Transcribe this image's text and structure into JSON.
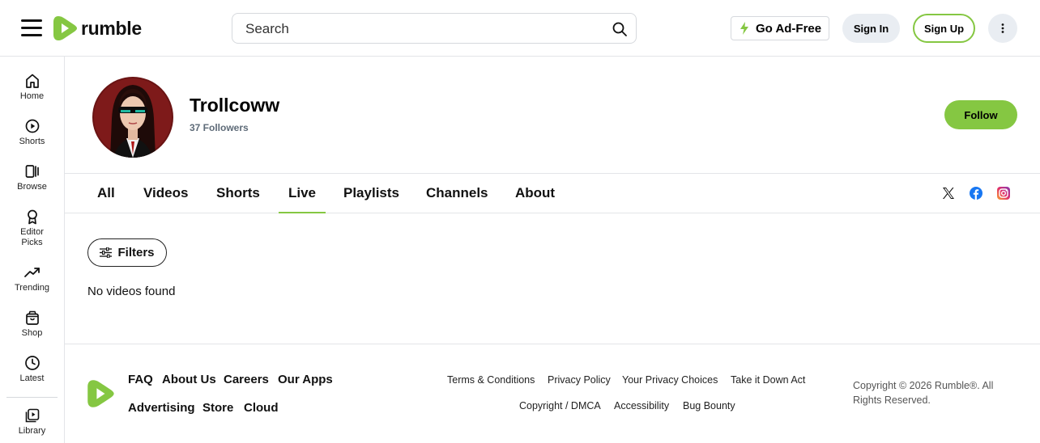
{
  "header": {
    "logo_text": "rumble",
    "search_placeholder": "Search",
    "ad_free_label": "Go Ad-Free",
    "sign_in_label": "Sign In",
    "sign_up_label": "Sign Up"
  },
  "sidebar": {
    "items": [
      {
        "label": "Home",
        "icon": "home-icon"
      },
      {
        "label": "Shorts",
        "icon": "shorts-icon"
      },
      {
        "label": "Browse",
        "icon": "browse-icon"
      },
      {
        "label": "Editor Picks",
        "icon": "ribbon-icon"
      },
      {
        "label": "Trending",
        "icon": "trending-icon"
      },
      {
        "label": "Shop",
        "icon": "shopping-bag-icon"
      },
      {
        "label": "Latest",
        "icon": "clock-icon"
      },
      {
        "label": "Library",
        "icon": "library-icon"
      }
    ]
  },
  "channel": {
    "name": "Trollcoww",
    "followers": "37 Followers",
    "follow_label": "Follow"
  },
  "tabs": [
    {
      "label": "All",
      "active": false
    },
    {
      "label": "Videos",
      "active": false
    },
    {
      "label": "Shorts",
      "active": false
    },
    {
      "label": "Live",
      "active": true
    },
    {
      "label": "Playlists",
      "active": false
    },
    {
      "label": "Channels",
      "active": false
    },
    {
      "label": "About",
      "active": false
    }
  ],
  "social": [
    "x-icon",
    "facebook-icon",
    "instagram-icon"
  ],
  "content": {
    "filters_label": "Filters",
    "empty_message": "No videos found"
  },
  "footer": {
    "primary_links": [
      "FAQ",
      "About Us",
      "Careers",
      "Our Apps",
      "Advertising",
      "Store",
      "Cloud"
    ],
    "secondary_links": [
      "Terms & Conditions",
      "Privacy Policy",
      "Your Privacy Choices",
      "Take it Down Act",
      "Copyright / DMCA",
      "Accessibility",
      "Bug Bounty"
    ],
    "copyright": "Copyright © 2026 Rumble®. All Rights Reserved."
  },
  "colors": {
    "brand_green": "#85c742",
    "border": "#e3e5e8",
    "button_gray": "#e9edf2",
    "facebook_blue": "#1877f2"
  }
}
